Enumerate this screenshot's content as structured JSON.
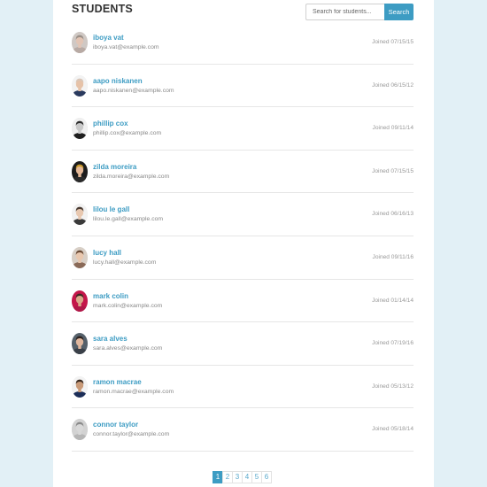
{
  "header": {
    "title": "STUDENTS",
    "search_placeholder": "Search for students...",
    "search_button": "Search"
  },
  "students": [
    {
      "name": "iboya vat",
      "email": "iboya.vat@example.com",
      "joined": "Joined 07/15/15",
      "hair": "#9a8f87",
      "skin": "#e2c4b4",
      "shirt": "#b8aaa4",
      "bg": "#cfc8c4"
    },
    {
      "name": "aapo niskanen",
      "email": "aapo.niskanen@example.com",
      "joined": "Joined 06/15/12",
      "hair": "#d9c6b8",
      "skin": "#e6c2a8",
      "shirt": "#2a3a5e",
      "bg": "#f3f3f3"
    },
    {
      "name": "phillip cox",
      "email": "phillip.cox@example.com",
      "joined": "Joined 09/11/14",
      "hair": "#2b2b2b",
      "skin": "#c9c9c9",
      "shirt": "#1f1f1f",
      "bg": "#f0f0f0"
    },
    {
      "name": "zilda moreira",
      "email": "zilda.moreira@example.com",
      "joined": "Joined 07/15/15",
      "hair": "#c99a2a",
      "skin": "#e5b998",
      "shirt": "#2a2a2a",
      "bg": "#1c1c1c"
    },
    {
      "name": "lilou le gall",
      "email": "lilou.le.gall@example.com",
      "joined": "Joined 06/16/13",
      "hair": "#4a3b32",
      "skin": "#e8c8b0",
      "shirt": "#3a3a3a",
      "bg": "#f2f2f2"
    },
    {
      "name": "lucy hall",
      "email": "lucy.hall@example.com",
      "joined": "Joined 09/11/16",
      "hair": "#6b4a35",
      "skin": "#e9c7ae",
      "shirt": "#8a6a58",
      "bg": "#d8cfc6"
    },
    {
      "name": "mark colin",
      "email": "mark.colin@example.com",
      "joined": "Joined 01/14/14",
      "hair": "#3b2a22",
      "skin": "#d9a98a",
      "shirt": "#b01848",
      "bg": "#c4164a"
    },
    {
      "name": "sara alves",
      "email": "sara.alves@example.com",
      "joined": "Joined 07/19/16",
      "hair": "#2d221e",
      "skin": "#e0b79e",
      "shirt": "#3a4048",
      "bg": "#55606a"
    },
    {
      "name": "ramon macrae",
      "email": "ramon.macrae@example.com",
      "joined": "Joined 05/13/12",
      "hair": "#3a2a20",
      "skin": "#c99a78",
      "shirt": "#1c2e58",
      "bg": "#f3f3f3"
    },
    {
      "name": "connor taylor",
      "email": "connor.taylor@example.com",
      "joined": "Joined 05/18/14",
      "hair": "#8a8a8a",
      "skin": "#d8d8d8",
      "shirt": "#b6b6b6",
      "bg": "#d2d2d2"
    }
  ],
  "pagination": {
    "pages": [
      "1",
      "2",
      "3",
      "4",
      "5",
      "6"
    ],
    "active_index": 0
  }
}
